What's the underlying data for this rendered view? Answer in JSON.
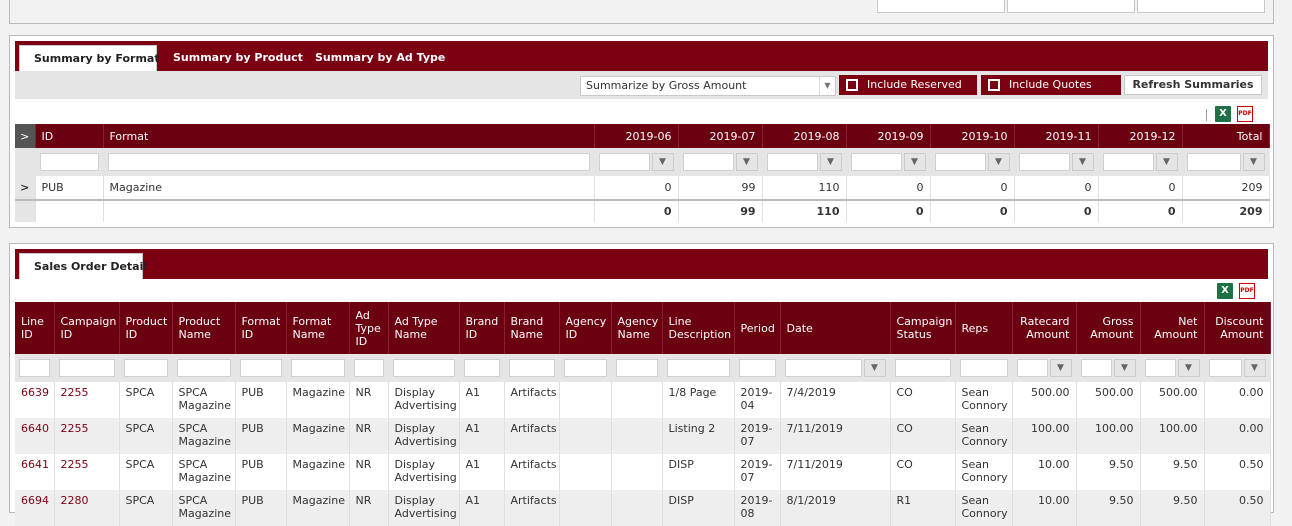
{
  "summary_tabs": [
    "Summary by Format",
    "Summary by Product",
    "Summary by Ad Type"
  ],
  "summarize_select": "Summarize by Gross Amount",
  "include_reserved": "Include Reserved",
  "include_quotes": "Include Quotes",
  "refresh_label": "Refresh Summaries",
  "excel_icon": "X",
  "pdf_icon": "PDF",
  "filter_icon": "▼",
  "row_arrow": ">",
  "summary_headers": [
    "ID",
    "Format",
    "2019-06",
    "2019-07",
    "2019-08",
    "2019-09",
    "2019-10",
    "2019-11",
    "2019-12",
    "Total"
  ],
  "summary_rows": [
    [
      "PUB",
      "Magazine",
      "0",
      "99",
      "110",
      "0",
      "0",
      "0",
      "0",
      "209"
    ]
  ],
  "summary_totals": [
    "0",
    "99",
    "110",
    "0",
    "0",
    "0",
    "0",
    "209"
  ],
  "detail_tab": "Sales Order Detail",
  "detail_headers": [
    "Line ID",
    "Campaign ID",
    "Product ID",
    "Product Name",
    "Format ID",
    "Format Name",
    "Ad Type ID",
    "Ad Type Name",
    "Brand ID",
    "Brand Name",
    "Agency ID",
    "Agency Name",
    "Line Description",
    "Period",
    "Date",
    "Campaign Status",
    "Reps",
    "Ratecard Amount",
    "Gross Amount",
    "Net Amount",
    "Discount Amount"
  ],
  "detail_rows": [
    [
      "6639",
      "2255",
      "SPCA",
      "SPCA Magazine",
      "PUB",
      "Magazine",
      "NR",
      "Display Advertising",
      "A1",
      "Artifacts",
      "",
      "",
      "1/8 Page",
      "2019-04",
      "7/4/2019",
      "CO",
      "Sean Connory",
      "500.00",
      "500.00",
      "500.00",
      "0.00"
    ],
    [
      "6640",
      "2255",
      "SPCA",
      "SPCA Magazine",
      "PUB",
      "Magazine",
      "NR",
      "Display Advertising",
      "A1",
      "Artifacts",
      "",
      "",
      "Listing 2",
      "2019-07",
      "7/11/2019",
      "CO",
      "Sean Connory",
      "100.00",
      "100.00",
      "100.00",
      "0.00"
    ],
    [
      "6641",
      "2255",
      "SPCA",
      "SPCA Magazine",
      "PUB",
      "Magazine",
      "NR",
      "Display Advertising",
      "A1",
      "Artifacts",
      "",
      "",
      "DISP",
      "2019-07",
      "7/11/2019",
      "CO",
      "Sean Connory",
      "10.00",
      "9.50",
      "9.50",
      "0.50"
    ],
    [
      "6694",
      "2280",
      "SPCA",
      "SPCA Magazine",
      "PUB",
      "Magazine",
      "NR",
      "Display Advertising",
      "A1",
      "Artifacts",
      "",
      "",
      "DISP",
      "2019-08",
      "8/1/2019",
      "R1",
      "Sean Connory",
      "10.00",
      "9.50",
      "9.50",
      "0.50"
    ]
  ],
  "colors": {
    "brand": "#7b0012",
    "header": "#6b0010",
    "link": "#7b0012"
  }
}
